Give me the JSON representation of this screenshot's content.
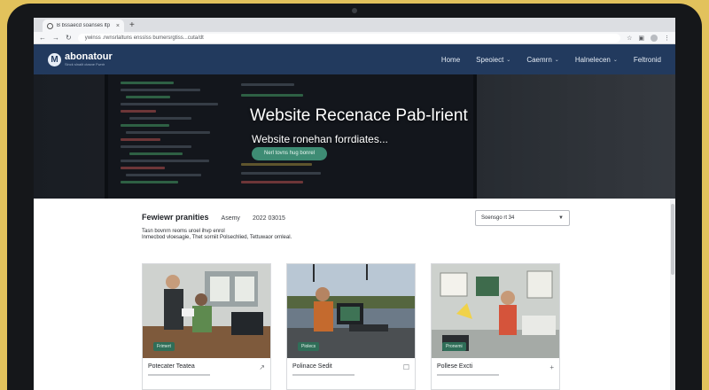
{
  "browser": {
    "tab_title": "B bssaecd soanses ltp",
    "tab_close": "×",
    "new_tab": "+",
    "url": "ywinss .rwnsrlaltuns ensslss bumersrgtiss...cuta/dt",
    "nav_icons": [
      "back-icon",
      "forward-icon",
      "reload-icon"
    ],
    "right_icons": [
      "bookmark-icon",
      "extensions-icon",
      "menu-icon"
    ]
  },
  "site": {
    "logo_mark": "M",
    "logo_name": "abonatour",
    "logo_sub": "Sinck slnaiit ctasne Fwntr",
    "menu": [
      {
        "label": "Home",
        "dropdown": false
      },
      {
        "label": "Speoiect",
        "dropdown": true
      },
      {
        "label": "Caemrn",
        "dropdown": true
      },
      {
        "label": "Halnelecen",
        "dropdown": true
      },
      {
        "label": "Feltronid",
        "dropdown": false
      }
    ]
  },
  "hero": {
    "title": "Website Recenace Pab-lrient",
    "subtitle": "Website ronehan forrdiates...",
    "cta": "Nerl tovns hug bonrel"
  },
  "content": {
    "filter_title": "Fewiewr pranities",
    "filter_meta1": "Asemy",
    "filter_meta2": "2022 03015",
    "select_value": "Soensgo rt 34",
    "desc_lines": [
      "Tasn bovnrn reoms uroel ihvp enrol",
      "Inmecbod vloesagie, Thet sorniit Polsechlied, Tettuwaor ornleal."
    ]
  },
  "cards": [
    {
      "badge": "Frimert",
      "title": "Potecater Teatea",
      "icon": "arrow-icon"
    },
    {
      "badge": "Piolecs",
      "title": "Polinace Sedit",
      "icon": "square-icon"
    },
    {
      "badge": "Pronemi",
      "title": "Pollese Excti",
      "icon": "plus-icon"
    }
  ],
  "colors": {
    "nav_bg": "#223a5e",
    "cta_bg": "#3e8c74",
    "badge_bg": "#2f6e58",
    "backdrop": "#e2c25c"
  }
}
